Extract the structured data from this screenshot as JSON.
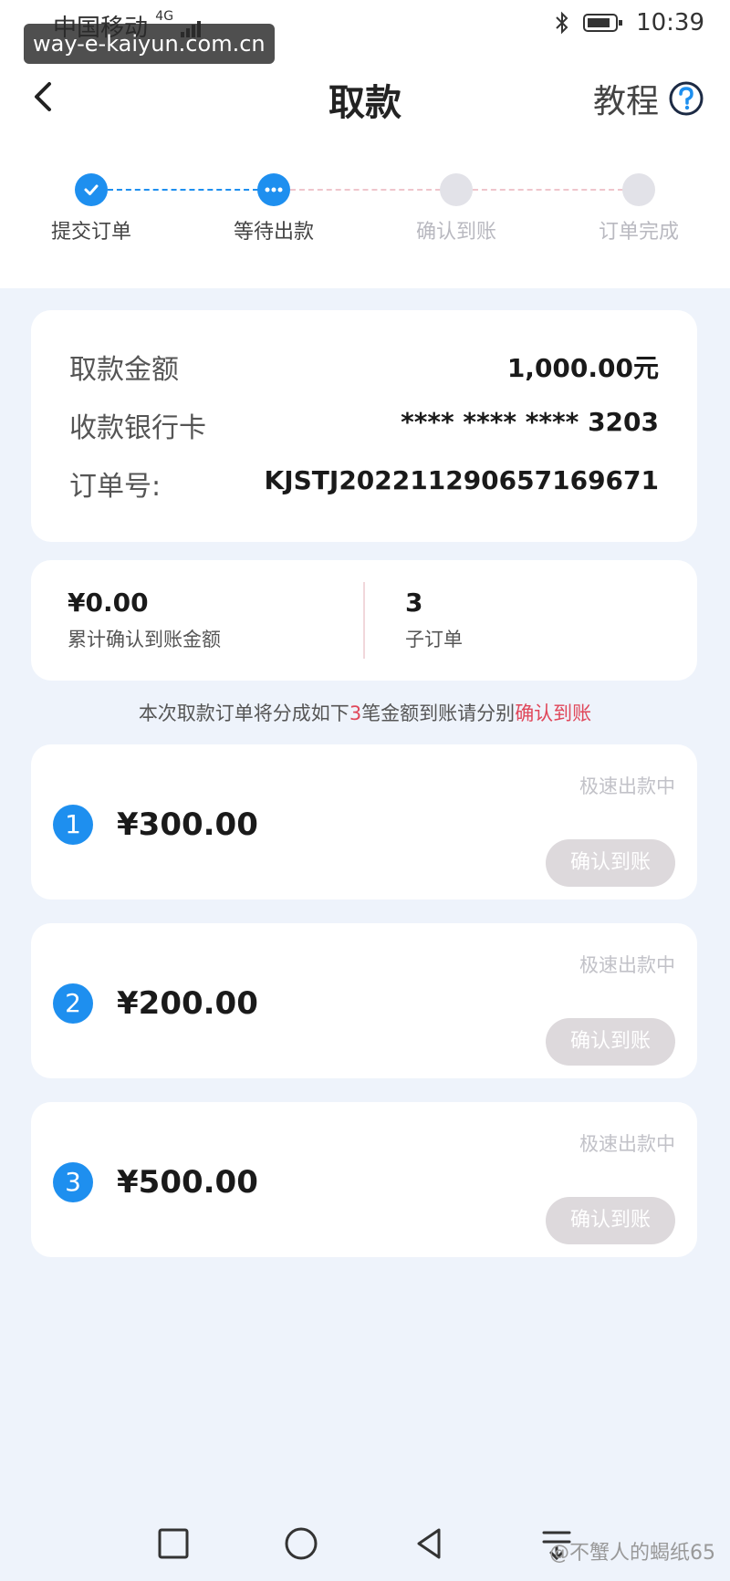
{
  "status_bar": {
    "carrier": "中国移动",
    "network": "4G",
    "time": "10:39"
  },
  "overlay_url": "way-e-kaiyun.com.cn",
  "header": {
    "title": "取款",
    "tutorial_label": "教程"
  },
  "steps": [
    {
      "label": "提交订单",
      "state": "done"
    },
    {
      "label": "等待出款",
      "state": "active"
    },
    {
      "label": "确认到账",
      "state": "pending"
    },
    {
      "label": "订单完成",
      "state": "pending"
    }
  ],
  "info": {
    "amount_label": "取款金额",
    "amount_value": "1,000.00元",
    "card_label": "收款银行卡",
    "card_value": "**** **** **** 3203",
    "order_label": "订单号:",
    "order_value": "KJSTJ202211290657169671"
  },
  "summary": {
    "confirmed_amount": "¥0.00",
    "confirmed_caption": "累计确认到账金额",
    "suborder_count": "3",
    "suborder_caption": "子订单"
  },
  "notice": {
    "prefix": "本次取款订单将分成如下",
    "count": "3",
    "middle": "笔金额到账请分别",
    "action": "确认到账"
  },
  "tranches": [
    {
      "index": "1",
      "amount": "¥300.00",
      "status": "极速出款中",
      "button": "确认到账"
    },
    {
      "index": "2",
      "amount": "¥200.00",
      "status": "极速出款中",
      "button": "确认到账"
    },
    {
      "index": "3",
      "amount": "¥500.00",
      "status": "极速出款中",
      "button": "确认到账"
    }
  ],
  "watermark": "@不蟹人的蝎纸65",
  "colors": {
    "accent": "#1e8fef",
    "highlight": "#e0475a",
    "disabled_button": "#ddd9dc"
  }
}
